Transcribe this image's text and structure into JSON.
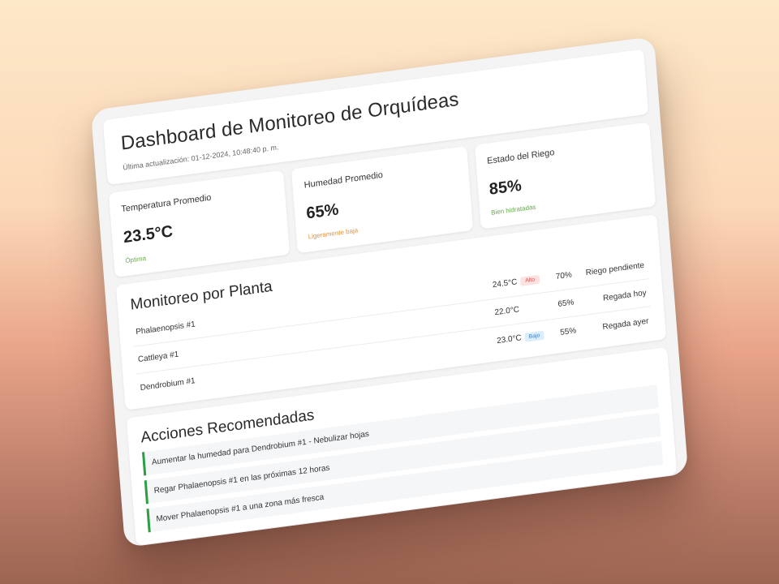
{
  "header": {
    "title": "Dashboard de Monitoreo de Orquídeas",
    "updated": "Última actualización: 01-12-2024, 10:48:40 p. m."
  },
  "stats": [
    {
      "label": "Temperatura Promedio",
      "value": "23.5°C",
      "status": "Óptima",
      "status_color": "#6aa84f"
    },
    {
      "label": "Humedad Promedio",
      "value": "65%",
      "status": "Ligeramente baja",
      "status_color": "#e69138"
    },
    {
      "label": "Estado del Riego",
      "value": "85%",
      "status": "Bien hidratadas",
      "status_color": "#6aa84f"
    }
  ],
  "plants": {
    "title": "Monitoreo por Planta",
    "rows": [
      {
        "name": "Phalaenopsis #1",
        "temp": "24.5°C",
        "badge": "Alto",
        "humidity": "70%",
        "watering": "Riego pendiente"
      },
      {
        "name": "Cattleya #1",
        "temp": "22.0°C",
        "badge": "",
        "humidity": "65%",
        "watering": "Regada hoy"
      },
      {
        "name": "Dendrobium #1",
        "temp": "23.0°C",
        "badge": "Bajo",
        "humidity": "55%",
        "watering": "Regada ayer"
      }
    ]
  },
  "actions": {
    "title": "Acciones Recomendadas",
    "items": [
      "Aumentar la humedad para Dendrobium #1 - Nebulizar hojas",
      "Regar Phalaenopsis #1 en las próximas 12 horas",
      "Mover Phalaenopsis #1 a una zona más fresca"
    ],
    "accent": "#2e9e44"
  }
}
